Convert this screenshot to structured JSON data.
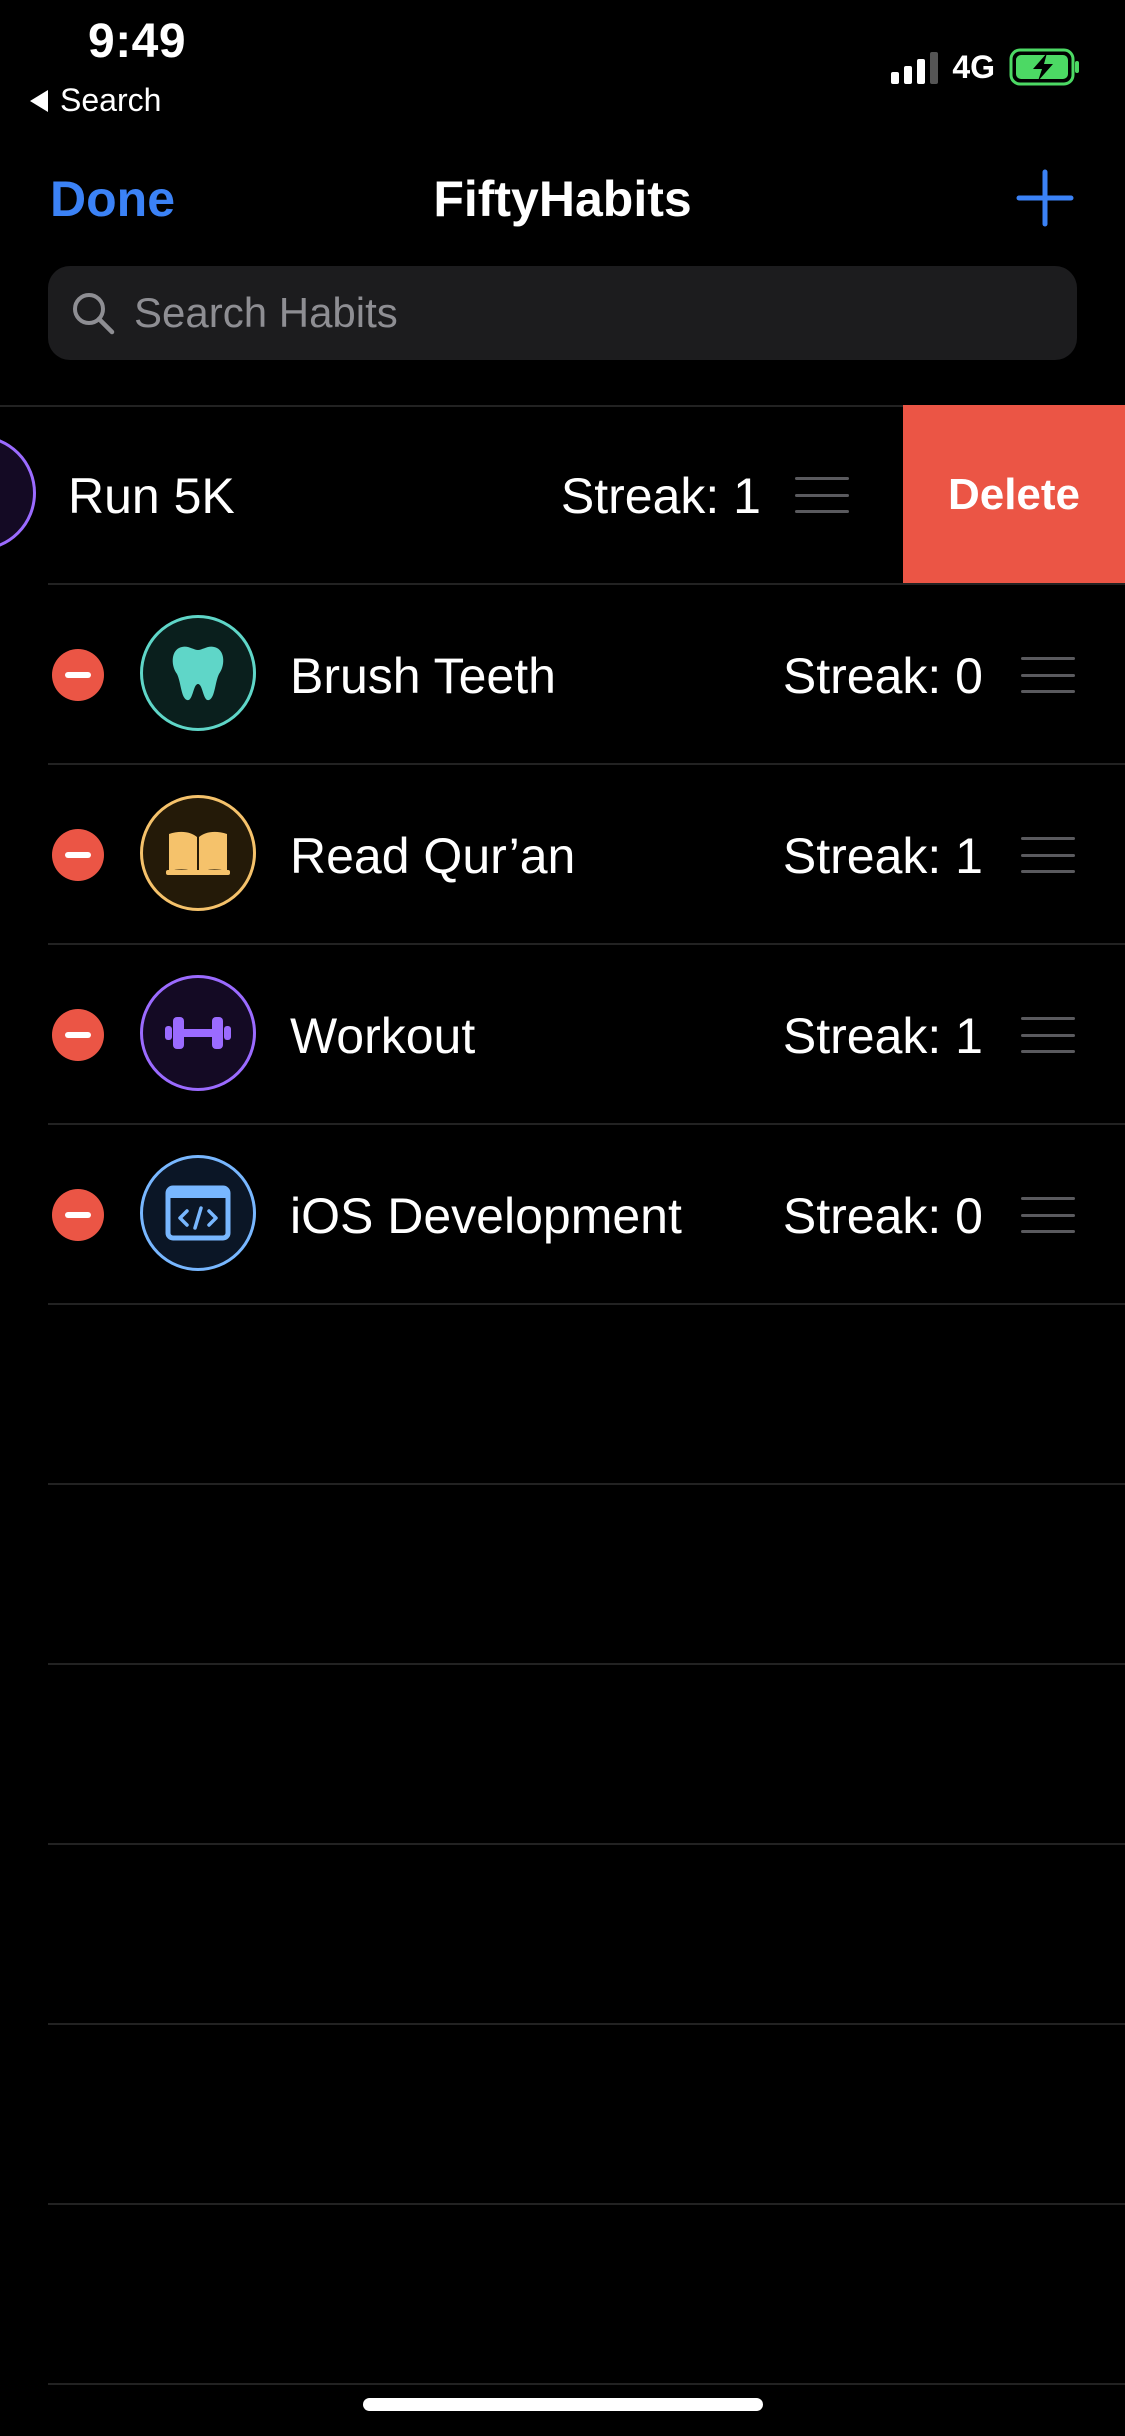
{
  "status": {
    "time": "9:49",
    "back_label": "Search",
    "network": "4G"
  },
  "nav": {
    "done_label": "Done",
    "title": "FiftyHabits"
  },
  "search": {
    "placeholder": "Search Habits"
  },
  "colors": {
    "accent": "#3b82f6",
    "destructive": "#eb5545",
    "battery": "#4cd964"
  },
  "habits": [
    {
      "name": "Run 5K",
      "streak": "Streak: 1",
      "icon": "run-icon",
      "color": "#9b6bff",
      "swiped": true,
      "action_label": "Delete"
    },
    {
      "name": "Brush Teeth",
      "streak": "Streak: 0",
      "icon": "tooth-icon",
      "color": "#5fd6c8"
    },
    {
      "name": "Read Qur’an",
      "streak": "Streak: 1",
      "icon": "book-icon",
      "color": "#f5c26b"
    },
    {
      "name": "Workout",
      "streak": "Streak: 1",
      "icon": "dumbbell-icon",
      "color": "#9b6bff"
    },
    {
      "name": "iOS Development",
      "streak": "Streak: 0",
      "icon": "code-icon",
      "color": "#78b7ff"
    }
  ]
}
